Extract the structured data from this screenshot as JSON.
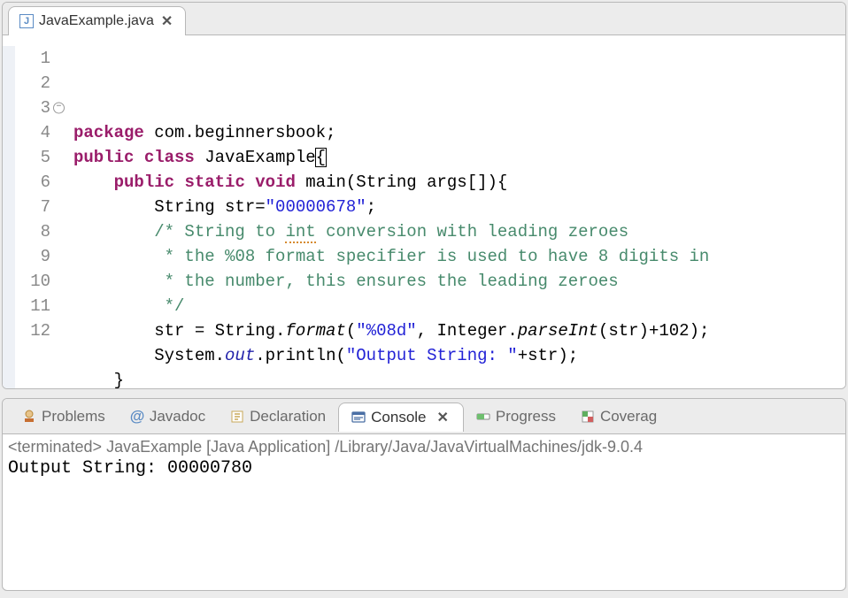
{
  "editor": {
    "tab": {
      "filename": "JavaExample.java"
    },
    "code": {
      "lines": [
        {
          "n": "1",
          "tokens": [
            [
              "kw",
              "package"
            ],
            [
              "",
              " com.beginnersbook;"
            ]
          ]
        },
        {
          "n": "2",
          "tokens": [
            [
              "kw",
              "public"
            ],
            [
              "",
              " "
            ],
            [
              "kw",
              "class"
            ],
            [
              "",
              " JavaExample"
            ],
            [
              "caret",
              "{"
            ]
          ]
        },
        {
          "n": "3",
          "fold": true,
          "tokens": [
            [
              "",
              "    "
            ],
            [
              "kw",
              "public"
            ],
            [
              "",
              " "
            ],
            [
              "kw",
              "static"
            ],
            [
              "",
              " "
            ],
            [
              "kw",
              "void"
            ],
            [
              "",
              " main(String args[]){"
            ]
          ]
        },
        {
          "n": "4",
          "tokens": [
            [
              "",
              "        String str="
            ],
            [
              "str",
              "\"00000678\""
            ],
            [
              "",
              ";"
            ]
          ]
        },
        {
          "n": "5",
          "tokens": [
            [
              "",
              "        "
            ],
            [
              "cmt",
              "/* String to "
            ],
            [
              "cmt-err",
              "int"
            ],
            [
              "cmt",
              " conversion with leading zeroes"
            ]
          ]
        },
        {
          "n": "6",
          "tokens": [
            [
              "",
              "         "
            ],
            [
              "cmt",
              "* the %08 format specifier is used to have 8 digits in"
            ]
          ]
        },
        {
          "n": "7",
          "tokens": [
            [
              "",
              "         "
            ],
            [
              "cmt",
              "* the number, this ensures the leading zeroes"
            ]
          ]
        },
        {
          "n": "8",
          "tokens": [
            [
              "",
              "         "
            ],
            [
              "cmt",
              "*/"
            ]
          ]
        },
        {
          "n": "9",
          "tokens": [
            [
              "",
              "        str = String."
            ],
            [
              "mtd",
              "format"
            ],
            [
              "",
              "("
            ],
            [
              "str",
              "\"%08d\""
            ],
            [
              "",
              ", Integer."
            ],
            [
              "mtd",
              "parseInt"
            ],
            [
              "",
              "(str)+102);"
            ]
          ]
        },
        {
          "n": "10",
          "tokens": [
            [
              "",
              "        System."
            ],
            [
              "fld",
              "out"
            ],
            [
              "",
              ".println("
            ],
            [
              "str",
              "\"Output String: \""
            ],
            [
              "",
              "+str);"
            ]
          ]
        },
        {
          "n": "11",
          "tokens": [
            [
              "",
              "    }"
            ]
          ]
        },
        {
          "n": "12",
          "highlight": true,
          "tokens": [
            [
              "",
              "}"
            ]
          ]
        }
      ]
    }
  },
  "views": {
    "problems": "Problems",
    "javadoc": "Javadoc",
    "declaration": "Declaration",
    "console": "Console",
    "progress": "Progress",
    "coverage": "Coverag"
  },
  "console": {
    "status": "<terminated> JavaExample [Java Application] /Library/Java/JavaVirtualMachines/jdk-9.0.4",
    "output": "Output String: 00000780"
  }
}
